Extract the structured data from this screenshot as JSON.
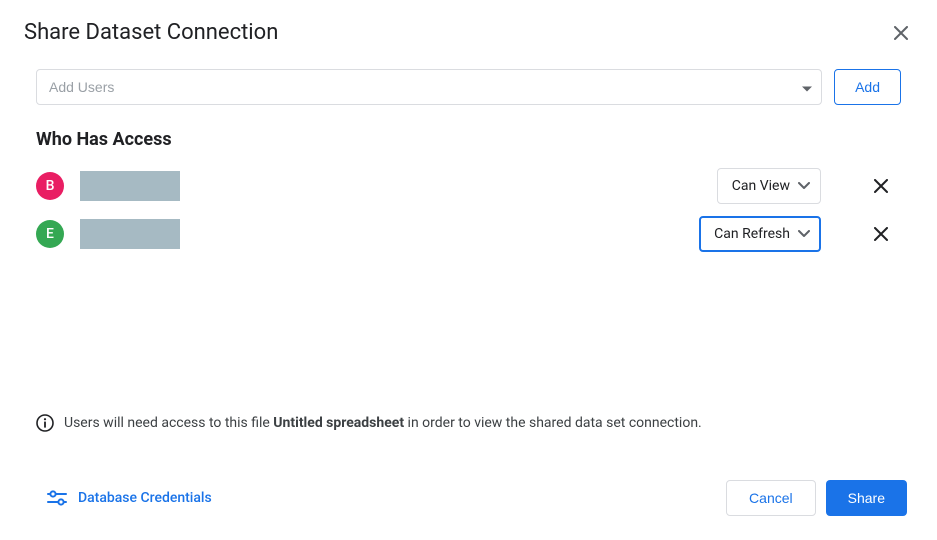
{
  "dialog": {
    "title": "Share Dataset Connection"
  },
  "add_users": {
    "placeholder": "Add Users",
    "add_button": "Add"
  },
  "access": {
    "section_title": "Who Has Access",
    "rows": [
      {
        "initial": "B",
        "avatar_color": "pink",
        "permission": "Can View",
        "active": false
      },
      {
        "initial": "E",
        "avatar_color": "green",
        "permission": "Can Refresh",
        "active": true
      }
    ]
  },
  "info": {
    "prefix": "Users will need access to this file ",
    "filename": "Untitled spreadsheet",
    "suffix": " in order to view the shared data set connection."
  },
  "footer": {
    "db_credentials": "Database Credentials",
    "cancel": "Cancel",
    "share": "Share"
  }
}
